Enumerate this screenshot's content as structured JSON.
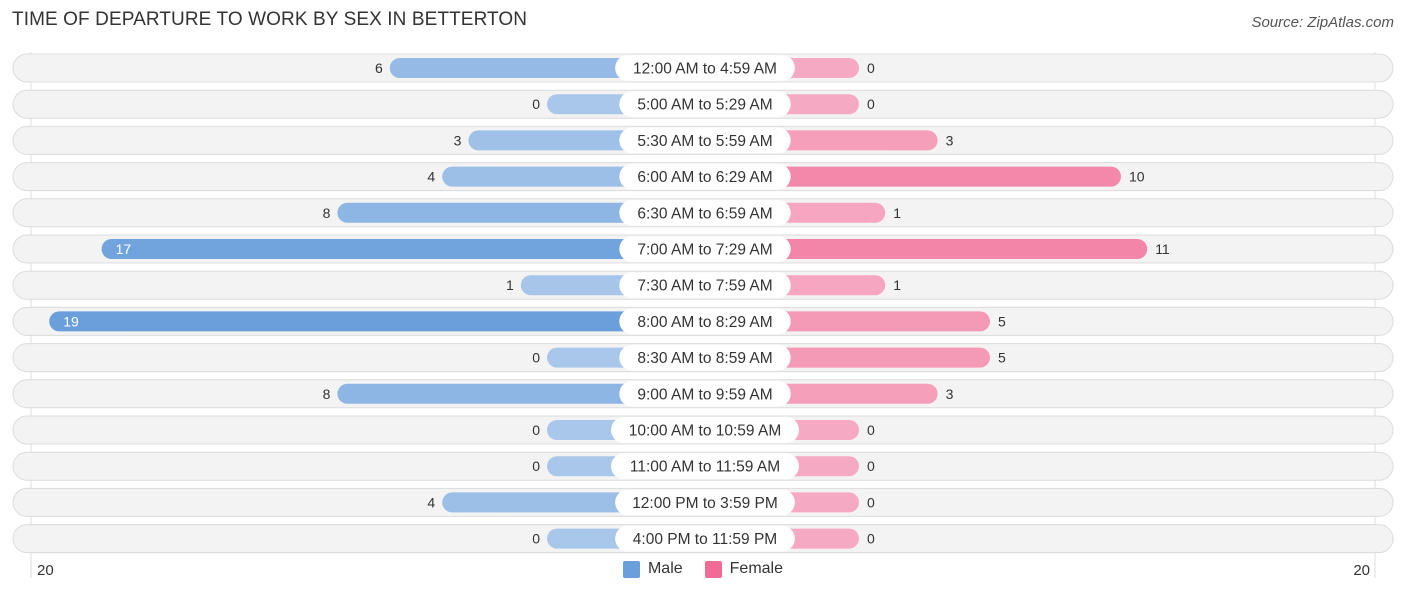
{
  "chart_data": {
    "type": "bar",
    "orientation": "horizontal-diverging",
    "title": "TIME OF DEPARTURE TO WORK BY SEX IN BETTERTON",
    "source": "Source: ZipAtlas.com",
    "categories": [
      "12:00 AM to 4:59 AM",
      "5:00 AM to 5:29 AM",
      "5:30 AM to 5:59 AM",
      "6:00 AM to 6:29 AM",
      "6:30 AM to 6:59 AM",
      "7:00 AM to 7:29 AM",
      "7:30 AM to 7:59 AM",
      "8:00 AM to 8:29 AM",
      "8:30 AM to 8:59 AM",
      "9:00 AM to 9:59 AM",
      "10:00 AM to 10:59 AM",
      "11:00 AM to 11:59 AM",
      "12:00 PM to 3:59 PM",
      "4:00 PM to 11:59 PM"
    ],
    "series": [
      {
        "name": "Male",
        "color": "#6a9fdb",
        "light_color": "#a9c7ea",
        "values": [
          6,
          0,
          3,
          4,
          8,
          17,
          1,
          19,
          0,
          8,
          0,
          0,
          4,
          0
        ]
      },
      {
        "name": "Female",
        "color": "#f06b96",
        "light_color": "#f6a9c2",
        "values": [
          0,
          0,
          3,
          10,
          1,
          11,
          1,
          5,
          5,
          3,
          0,
          0,
          0,
          0
        ]
      }
    ],
    "xlim": [
      20,
      20
    ],
    "axis_left_label": "20",
    "axis_right_label": "20",
    "legend_position": "bottom-center",
    "grid": false
  }
}
